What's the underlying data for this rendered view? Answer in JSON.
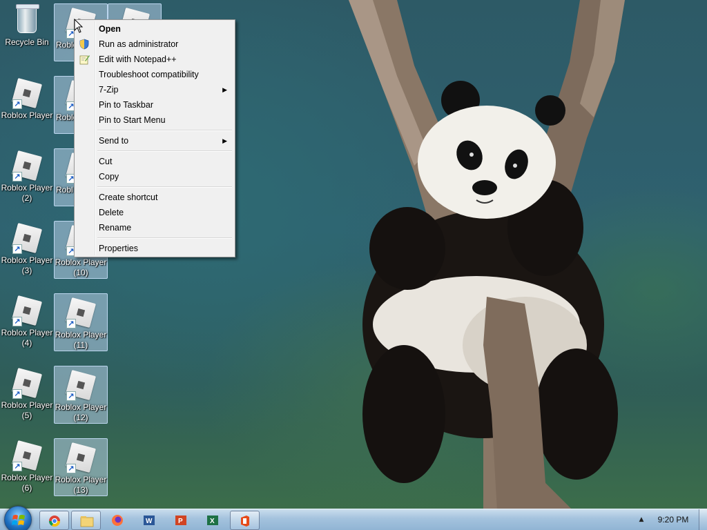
{
  "desktop": {
    "icons": [
      {
        "label": "Recycle Bin"
      },
      {
        "label": "Roblox Player"
      },
      {
        "label": "Roblox Player"
      },
      {
        "label": "Roblox Player (2)"
      },
      {
        "label": "Roblox Player (3)"
      },
      {
        "label": "Roblox Player (4)"
      },
      {
        "label": "Roblox Player (5)"
      },
      {
        "label": "Roblox Player (6)"
      },
      {
        "label": "Roblox Player (10)"
      },
      {
        "label": "Roblox Player (11)"
      },
      {
        "label": "Roblox Player (12)"
      },
      {
        "label": "Roblox Player (13)"
      }
    ],
    "partial_labels": {
      "row0": "Roblo",
      "row1": "Roblo",
      "row2": "Robl"
    }
  },
  "context_menu": {
    "items": [
      {
        "label": "Open"
      },
      {
        "label": "Run as administrator",
        "icon": "uac-shield-icon"
      },
      {
        "label": "Edit with Notepad++",
        "icon": "notepad-plus-plus-icon"
      },
      {
        "label": "Troubleshoot compatibility"
      },
      {
        "label": "7-Zip"
      },
      {
        "label": "Pin to Taskbar"
      },
      {
        "label": "Pin to Start Menu"
      },
      {
        "label": "Send to"
      },
      {
        "label": "Cut"
      },
      {
        "label": "Copy"
      },
      {
        "label": "Create shortcut"
      },
      {
        "label": "Delete"
      },
      {
        "label": "Rename"
      },
      {
        "label": "Properties"
      }
    ]
  },
  "taskbar": {
    "pinned": [
      "chrome-icon",
      "explorer-icon",
      "firefox-icon",
      "word-icon",
      "powerpoint-icon",
      "excel-icon",
      "office-icon"
    ],
    "clock": "9:20 PM"
  },
  "colors": {
    "selection": "#b4cde6",
    "menu_bg": "#f0f0f0",
    "taskbar": "#aac8e4"
  }
}
